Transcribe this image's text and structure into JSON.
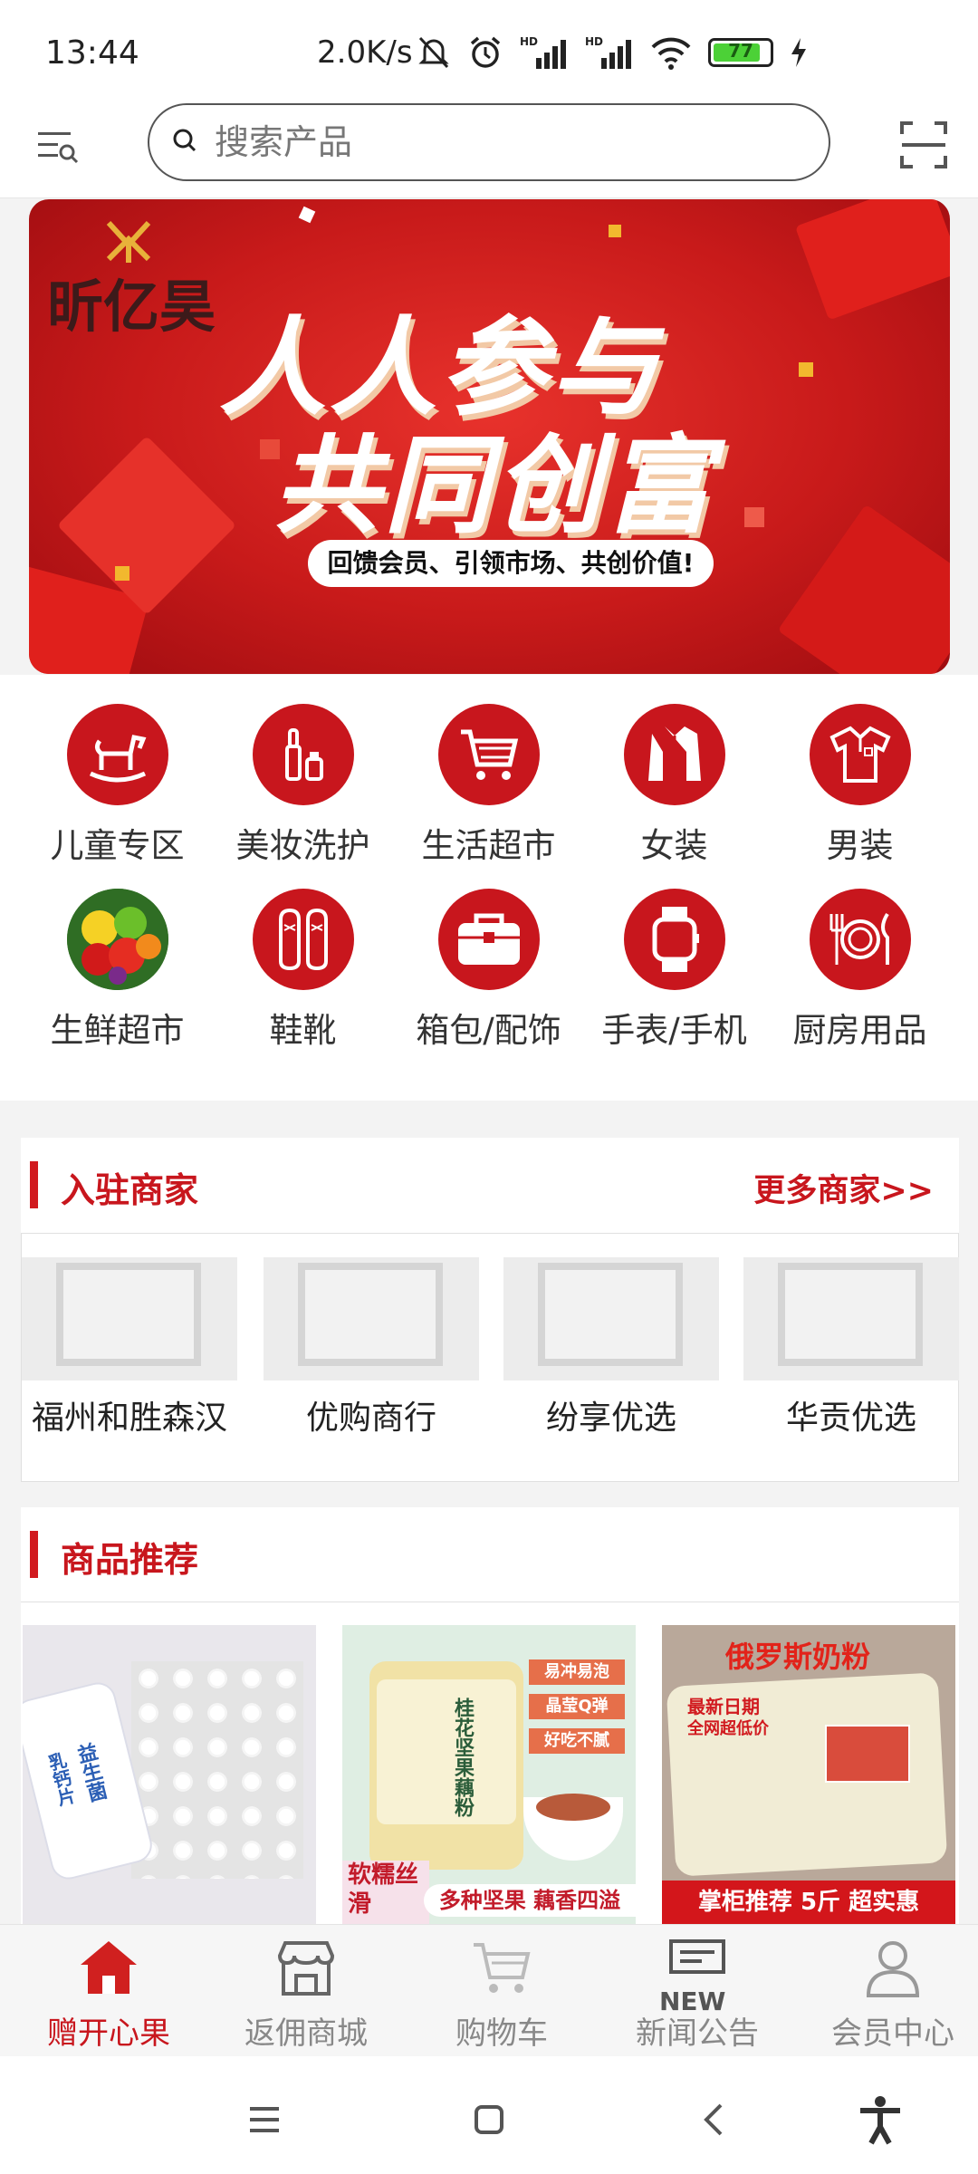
{
  "status_bar": {
    "time": "13:44",
    "network_speed": "2.0K/s",
    "battery": "77",
    "icons": [
      "mute-bell-icon",
      "alarm-icon",
      "hd-signal-icon",
      "hd-signal-icon",
      "wifi-icon",
      "battery-icon",
      "charging-icon"
    ]
  },
  "header": {
    "search_placeholder": "搜索产品"
  },
  "banner": {
    "brand": "昕亿昊",
    "headline_1": "人人参与",
    "headline_2": "共同创富",
    "tagline": "回馈会员、引领市场、共创价值!"
  },
  "categories": [
    {
      "label": "儿童专区",
      "icon": "rocking-horse-icon"
    },
    {
      "label": "美妆洗护",
      "icon": "cosmetics-icon"
    },
    {
      "label": "生活超市",
      "icon": "cart-icon"
    },
    {
      "label": "女装",
      "icon": "coat-icon"
    },
    {
      "label": "男装",
      "icon": "shirt-icon"
    },
    {
      "label": "生鲜超市",
      "icon": "fruit-icon"
    },
    {
      "label": "鞋靴",
      "icon": "shoes-icon"
    },
    {
      "label": "箱包/配饰",
      "icon": "bag-icon"
    },
    {
      "label": "手表/手机",
      "icon": "watch-icon"
    },
    {
      "label": "厨房用品",
      "icon": "dining-icon"
    }
  ],
  "merchants": {
    "title": "入驻商家",
    "more": "更多商家>>",
    "items": [
      "福州和胜森汉",
      "优购商行",
      "纷享优选",
      "华贡优选"
    ]
  },
  "products": {
    "title": "商品推荐",
    "items": [
      {
        "caption_1": "益生菌",
        "caption_2": "乳钙片"
      },
      {
        "caption_1": "桂花坚果藕粉",
        "caption_2": "易冲易泡",
        "caption_3": "晶莹Q弹",
        "caption_4": "好吃不腻",
        "caption_5": "软糯丝滑",
        "caption_6": "多种坚果 藕香四溢"
      },
      {
        "caption_1": "俄罗斯奶粉",
        "caption_2": "最新日期",
        "caption_3": "全网超低价",
        "caption_4": "掌柜推荐 5斤 超实惠"
      }
    ]
  },
  "tabbar": [
    {
      "label": "赠开心果",
      "icon": "home-icon",
      "active": true
    },
    {
      "label": "返佣商城",
      "icon": "store-icon",
      "active": false
    },
    {
      "label": "购物车",
      "icon": "cart-icon",
      "active": false
    },
    {
      "label": "新闻公告",
      "icon": "news-icon",
      "badge": "NEW",
      "active": false
    },
    {
      "label": "会员中心",
      "icon": "user-icon",
      "active": false
    }
  ],
  "colors": {
    "accent": "#c8161d",
    "banner": "#d8231f"
  }
}
